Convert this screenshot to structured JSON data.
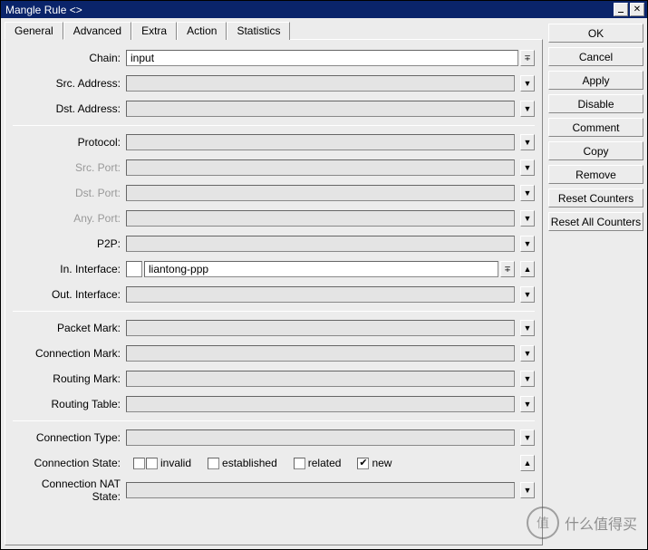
{
  "window": {
    "title": "Mangle Rule <>"
  },
  "tabs": [
    {
      "label": "General"
    },
    {
      "label": "Advanced"
    },
    {
      "label": "Extra"
    },
    {
      "label": "Action"
    },
    {
      "label": "Statistics"
    }
  ],
  "fields": {
    "chain": {
      "label": "Chain:",
      "value": "input"
    },
    "src_address": {
      "label": "Src. Address:",
      "value": ""
    },
    "dst_address": {
      "label": "Dst. Address:",
      "value": ""
    },
    "protocol": {
      "label": "Protocol:",
      "value": ""
    },
    "src_port": {
      "label": "Src. Port:",
      "value": ""
    },
    "dst_port": {
      "label": "Dst. Port:",
      "value": ""
    },
    "any_port": {
      "label": "Any. Port:",
      "value": ""
    },
    "p2p": {
      "label": "P2P:",
      "value": ""
    },
    "in_interface": {
      "label": "In. Interface:",
      "value": "liantong-ppp"
    },
    "out_interface": {
      "label": "Out. Interface:",
      "value": ""
    },
    "packet_mark": {
      "label": "Packet Mark:",
      "value": ""
    },
    "connection_mark": {
      "label": "Connection Mark:",
      "value": ""
    },
    "routing_mark": {
      "label": "Routing Mark:",
      "value": ""
    },
    "routing_table": {
      "label": "Routing Table:",
      "value": ""
    },
    "connection_type": {
      "label": "Connection Type:",
      "value": ""
    },
    "connection_state": {
      "label": "Connection State:"
    },
    "connection_nat": {
      "label": "Connection NAT State:",
      "value": ""
    }
  },
  "connection_state": {
    "invalid": {
      "label": "invalid",
      "checked": false
    },
    "established": {
      "label": "established",
      "checked": false
    },
    "related": {
      "label": "related",
      "checked": false
    },
    "new": {
      "label": "new",
      "checked": true
    }
  },
  "buttons": {
    "ok": "OK",
    "cancel": "Cancel",
    "apply": "Apply",
    "disable": "Disable",
    "comment": "Comment",
    "copy": "Copy",
    "remove": "Remove",
    "reset_counters": "Reset Counters",
    "reset_all_counters": "Reset All Counters"
  },
  "watermark": {
    "icon": "值",
    "text": "什么值得买"
  }
}
